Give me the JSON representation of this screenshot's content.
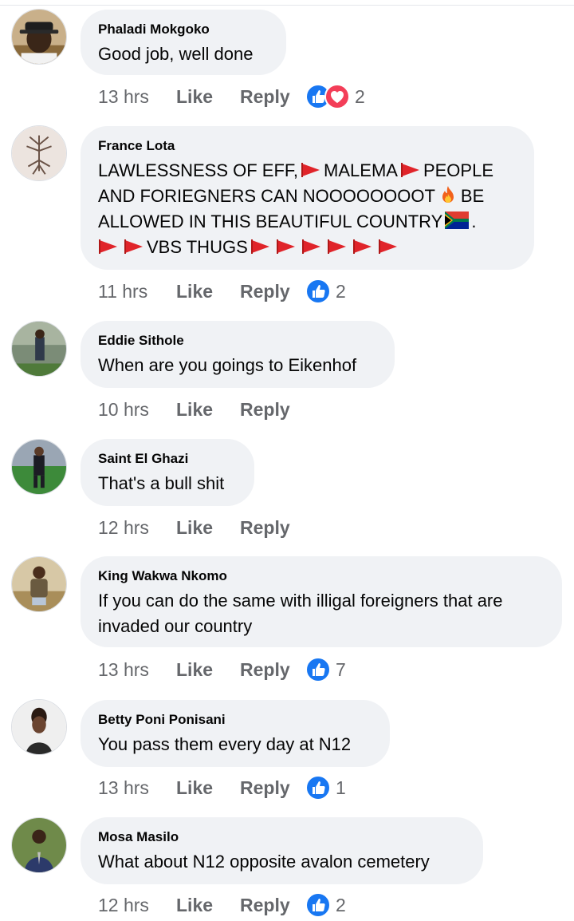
{
  "comments": [
    {
      "author": "Phaladi Mokgoko",
      "time": "13 hrs",
      "like": "Like",
      "reply": "Reply",
      "reaction_count": "2",
      "reactions": [
        "like-icon",
        "love-icon"
      ]
    },
    {
      "author": "France Lota",
      "time": "11 hrs",
      "like": "Like",
      "reply": "Reply",
      "reaction_count": "2",
      "reactions": [
        "like-icon"
      ]
    },
    {
      "author": "Eddie Sithole",
      "text": "When are you goings to Eikenhof",
      "time": "10 hrs",
      "like": "Like",
      "reply": "Reply"
    },
    {
      "author": "Saint El Ghazi",
      "text": "That's a bull shit",
      "time": "12 hrs",
      "like": "Like",
      "reply": "Reply"
    },
    {
      "author": "King Wakwa Nkomo",
      "text_lines": [
        "If you can do the same with illigal foreigners that are",
        "invaded our country"
      ],
      "time": "13 hrs",
      "like": "Like",
      "reply": "Reply",
      "reaction_count": "7",
      "reactions": [
        "like-icon"
      ]
    },
    {
      "author": "Betty Poni Ponisani",
      "text": "You pass them every day at N12",
      "time": "13 hrs",
      "like": "Like",
      "reply": "Reply",
      "reaction_count": "1",
      "reactions": [
        "like-icon"
      ]
    },
    {
      "author": "Mosa Masilo",
      "text": "What about N12 opposite avalon cemetery",
      "time": "12 hrs",
      "like": "Like",
      "reply": "Reply",
      "reaction_count": "2",
      "reactions": [
        "like-icon"
      ]
    }
  ],
  "first_comment_text": "Good job, well done",
  "france_text": {
    "l1a": "LAWLESSNESS OF EFF,",
    "l1b": "MALEMA",
    "l1c": "PEOPLE",
    "l2a": "AND FORIEGNERS CAN NOOOOOOOOT",
    "l2b": "BE",
    "l3a": "ALLOWED IN THIS BEAUTIFUL COUNTRY",
    "l3b": ".",
    "l4a": "VBS THUGS"
  },
  "colors": {
    "bubble": "#f0f2f5",
    "meta_text": "#65676b",
    "like_blue": "#1877f2",
    "love_red": "#f33e58",
    "flag_red": "#e0242a"
  }
}
